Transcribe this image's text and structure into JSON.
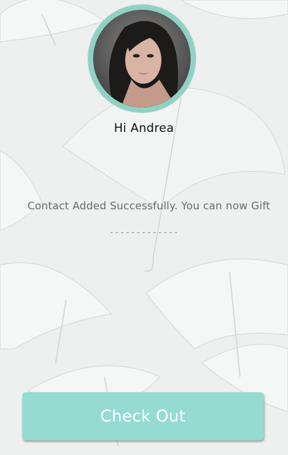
{
  "profile": {
    "avatar_icon": "woman-portrait-photo",
    "greeting": "Hi Andrea"
  },
  "status": {
    "message": "Contact Added Successfully. You can now Gift",
    "separator": "-------------"
  },
  "actions": {
    "checkout_label": "Check Out"
  },
  "colors": {
    "accent": "#95dbd2",
    "ring": "#8fd2c4",
    "background": "#eeefef"
  }
}
